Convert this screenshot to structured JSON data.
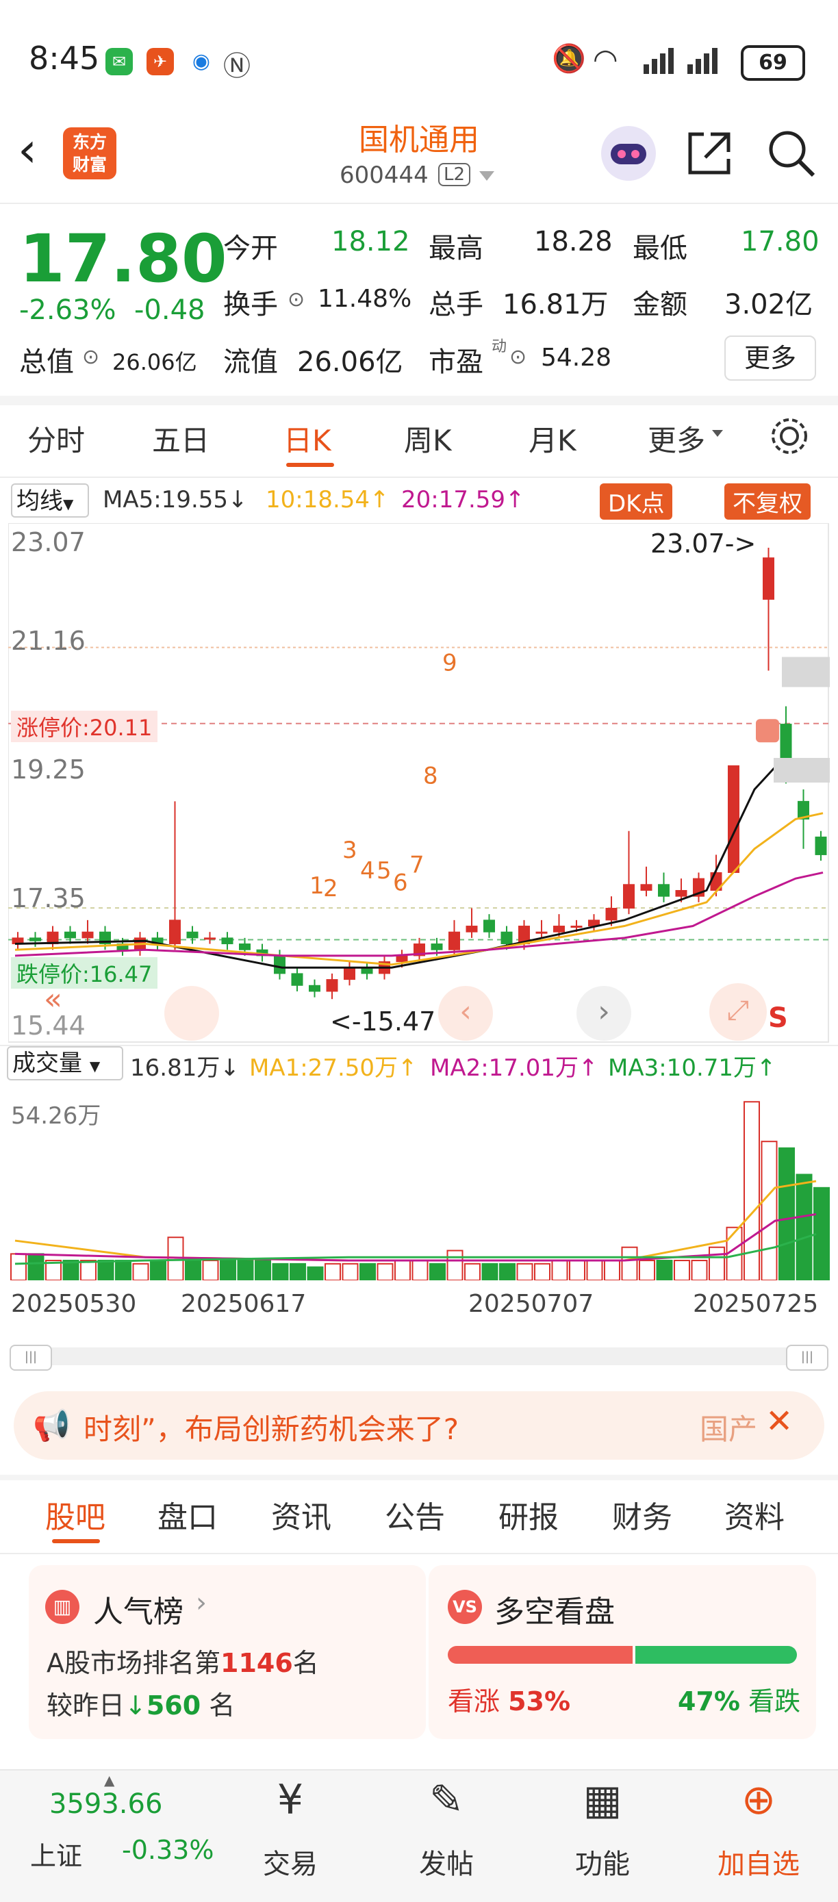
{
  "status_bar": {
    "time": "8:45",
    "battery": "69"
  },
  "header": {
    "title": "国机通用",
    "code": "600444",
    "level": "L2",
    "logo_line1": "东方",
    "logo_line2": "财富"
  },
  "quote": {
    "price": "17.80",
    "change_pct": "-2.63%",
    "change": "-0.48",
    "open_label": "今开",
    "open": "18.12",
    "high_label": "最高",
    "high": "18.28",
    "low_label": "最低",
    "low": "17.80",
    "turnover_label": "换手",
    "turnover": "11.48%",
    "volume_label": "总手",
    "volume": "16.81万",
    "amount_label": "金额",
    "amount": "3.02亿",
    "mcap_label": "总值",
    "mcap": "26.06亿",
    "float_label": "流值",
    "float": "26.06亿",
    "pe_label": "市盈",
    "pe_sup": "动",
    "pe": "54.28",
    "more": "更多"
  },
  "chart_tabs": [
    "分时",
    "五日",
    "日K",
    "周K",
    "月K",
    "更多"
  ],
  "chart_tabs_active": 2,
  "kline": {
    "indicator": "均线",
    "ma5": "MA5:19.55↓",
    "ma10": "10:18.54↑",
    "ma20": "20:17.59↑",
    "dk_button": "DK点",
    "adjust_button": "不复权",
    "y_labels": [
      "23.07",
      "21.16",
      "19.25",
      "17.35",
      "15.44"
    ],
    "limit_up": "涨停价:20.11",
    "limit_down": "跌停价:16.47",
    "max_note": "23.07->",
    "min_note": "<-15.47",
    "markers": [
      "1",
      "2",
      "3",
      "4",
      "5",
      "6",
      "7",
      "8",
      "9"
    ]
  },
  "volume": {
    "indicator": "成交量",
    "current": "16.81万↓",
    "ma1": "MA1:27.50万↑",
    "ma2": "MA2:17.01万↑",
    "ma3": "MA3:10.71万↑",
    "max_label": "54.26万",
    "dates": [
      "20250530",
      "20250617",
      "20250707",
      "20250725"
    ]
  },
  "banner": {
    "text": "时刻”，布局创新药机会来了?",
    "right": "国产"
  },
  "info_tabs": [
    "股吧",
    "盘口",
    "资讯",
    "公告",
    "研报",
    "财务",
    "资料"
  ],
  "info_tabs_active": 0,
  "popularity": {
    "title": "人气榜",
    "line1_pre": "A股市场排名第",
    "rank": "1146",
    "line1_post": "名",
    "line2_pre": "较昨日",
    "delta": "560",
    "line2_post": "名"
  },
  "sentiment": {
    "title": "多空看盘",
    "bull_label": "看涨",
    "bull_pct": "53%",
    "bear_pct": "47%",
    "bear_label": "看跌"
  },
  "bottom_nav": {
    "index_value": "3593.66",
    "index_name": "上证",
    "index_change": "-0.33%",
    "items": [
      "交易",
      "发帖",
      "功能",
      "加自选"
    ]
  },
  "colors": {
    "up": "#e0332b",
    "down": "#1a9e37",
    "accent": "#f0620f",
    "ma5": "#111111",
    "ma10": "#f2b21b",
    "ma20": "#c0188f"
  }
}
